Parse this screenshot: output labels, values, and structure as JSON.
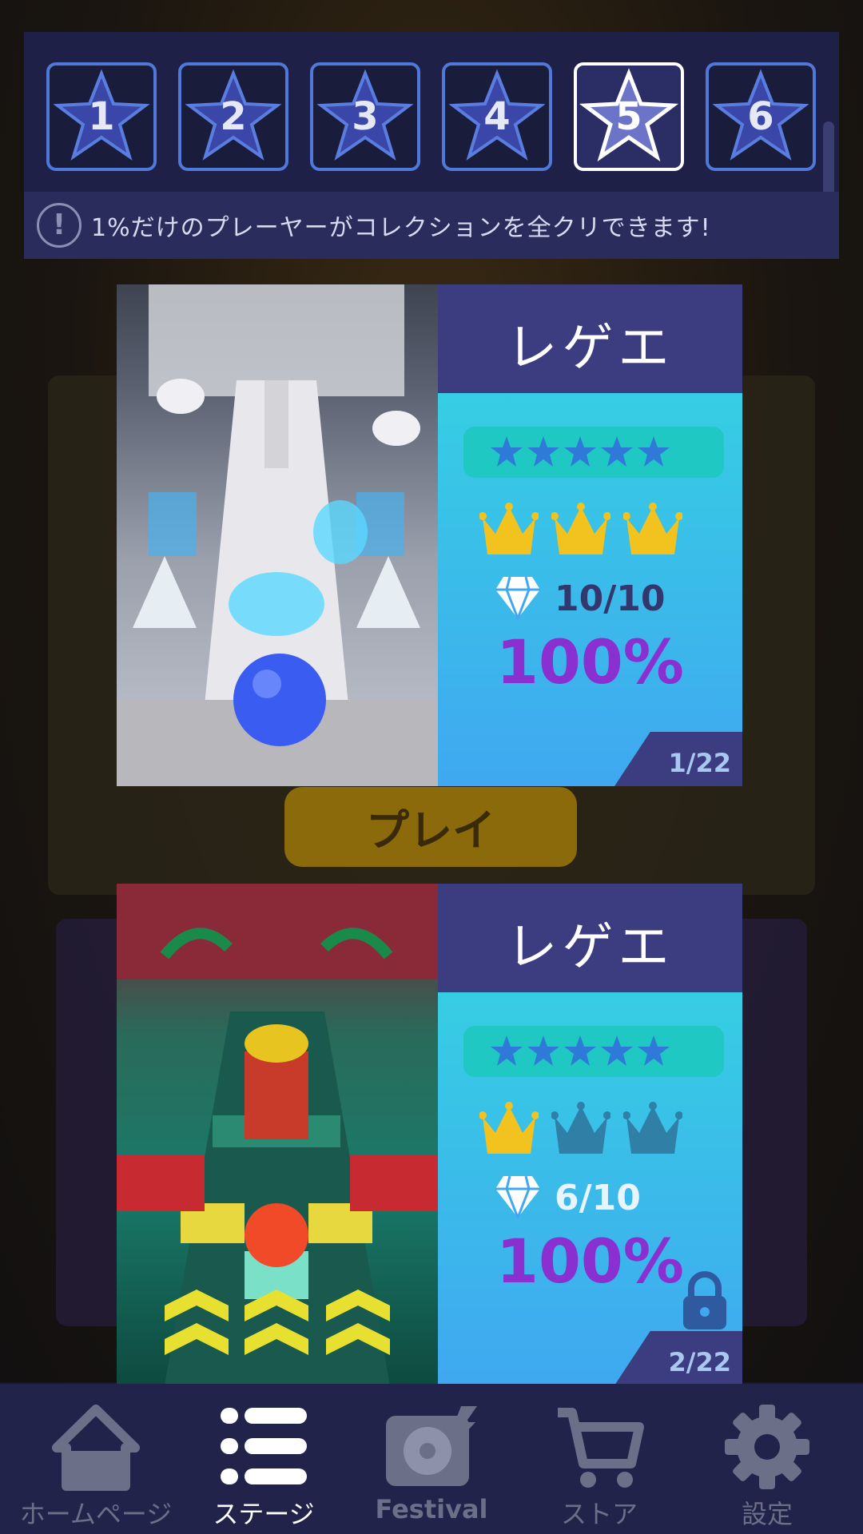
{
  "collection": {
    "levels": [
      {
        "label": "1",
        "active": false
      },
      {
        "label": "2",
        "active": false
      },
      {
        "label": "3",
        "active": false
      },
      {
        "label": "4",
        "active": false
      },
      {
        "label": "5",
        "active": true
      },
      {
        "label": "6",
        "active": false
      }
    ],
    "info_icon": "exclamation-icon",
    "info_text": "1%だけのプレーヤーがコレクションを全クリできます!"
  },
  "background": {
    "play_label": "プレイ"
  },
  "songs": [
    {
      "title": "レゲエ",
      "stars": 5,
      "crowns_earned": 3,
      "crowns_total": 3,
      "gems": "10/10",
      "percent": "100%",
      "counter": "1/22",
      "locked": false
    },
    {
      "title": "レゲエ",
      "stars": 5,
      "crowns_earned": 1,
      "crowns_total": 3,
      "gems": "6/10",
      "percent": "100%",
      "counter": "2/22",
      "locked": true
    }
  ],
  "nav": [
    {
      "label": "ホームページ",
      "icon": "home-icon",
      "active": false
    },
    {
      "label": "ステージ",
      "icon": "list-icon",
      "active": true
    },
    {
      "label": "Festival",
      "icon": "disc-icon",
      "active": false
    },
    {
      "label": "ストア",
      "icon": "cart-icon",
      "active": false
    },
    {
      "label": "設定",
      "icon": "gear-icon",
      "active": false
    }
  ],
  "colors": {
    "accent_purple": "#8a2fd0",
    "crown_gold": "#f2c21e",
    "crown_dim": "#2f7fa6",
    "active_border": "#ffffff",
    "level_border": "#4f78d8"
  }
}
